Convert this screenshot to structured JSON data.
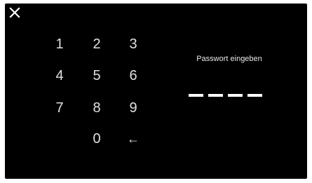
{
  "screen": {
    "close_icon": "close-icon",
    "prompt": "Passwort eingeben",
    "pin_length": 4,
    "entered_digits": 0
  },
  "keypad": {
    "k1": "1",
    "k2": "2",
    "k3": "3",
    "k4": "4",
    "k5": "5",
    "k6": "6",
    "k7": "7",
    "k8": "8",
    "k9": "9",
    "k0": "0",
    "backspace": "←"
  },
  "colors": {
    "background": "#000000",
    "text": "#ffffff"
  }
}
